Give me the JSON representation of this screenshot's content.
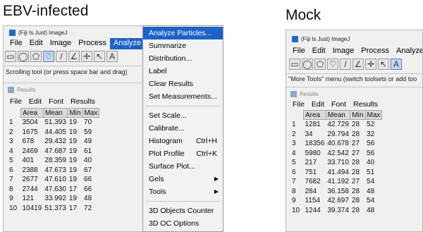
{
  "captions": {
    "left": "EBV-infected",
    "right": "Mock"
  },
  "left": {
    "title": "(Fiji Is Just) ImageJ",
    "menus": [
      "File",
      "Edit",
      "Image",
      "Process",
      "Analyze"
    ],
    "active_menu": "Analyze",
    "status": "Scrolling tool (or press space bar and drag)",
    "results_title": "Results",
    "results_menus": [
      "File",
      "Edit",
      "Font",
      "Results"
    ],
    "columns": [
      "",
      "Area",
      "Mean",
      "Min",
      "Max"
    ],
    "rows": [
      [
        "1",
        "3504",
        "51.393",
        "19",
        "70"
      ],
      [
        "2",
        "1675",
        "44.405",
        "19",
        "59"
      ],
      [
        "3",
        "678",
        "29.432",
        "19",
        "49"
      ],
      [
        "4",
        "2469",
        "47.687",
        "19",
        "61"
      ],
      [
        "5",
        "401",
        "28.359",
        "19",
        "40"
      ],
      [
        "6",
        "2388",
        "47.673",
        "19",
        "67"
      ],
      [
        "7",
        "2677",
        "47.610",
        "19",
        "66"
      ],
      [
        "8",
        "2744",
        "47.630",
        "17",
        "66"
      ],
      [
        "9",
        "121",
        "33.992",
        "19",
        "48"
      ],
      [
        "10",
        "10419",
        "51.373",
        "17",
        "72"
      ]
    ]
  },
  "analyze_menu": {
    "items": [
      {
        "label": "Analyze Particles...",
        "highlighted": true
      },
      {
        "label": "Summarize"
      },
      {
        "label": "Distribution..."
      },
      {
        "label": "Label"
      },
      {
        "label": "Clear Results"
      },
      {
        "label": "Set Measurements..."
      },
      {
        "label": "Set Scale...",
        "sep_before": true
      },
      {
        "label": "Calibrate..."
      },
      {
        "label": "Histogram",
        "shortcut": "Ctrl+H"
      },
      {
        "label": "Plot Profile",
        "shortcut": "Ctrl+K"
      },
      {
        "label": "Surface Plot..."
      },
      {
        "label": "Gels",
        "submenu": true
      },
      {
        "label": "Tools",
        "submenu": true
      },
      {
        "label": "3D Objects Counter",
        "sep_before": true
      },
      {
        "label": "3D OC Options"
      }
    ]
  },
  "right": {
    "title": "(Fiji Is Just) ImageJ",
    "menus": [
      "File",
      "Edit",
      "Image",
      "Process",
      "Analyze"
    ],
    "status": "\"More Tools\" menu (switch toolsets or add too",
    "results_title": "Results",
    "results_menus": [
      "File",
      "Edit",
      "Font",
      "Results"
    ],
    "columns": [
      "",
      "Area",
      "Mean",
      "Min",
      "Max"
    ],
    "rows": [
      [
        "1",
        "1281",
        "42.729",
        "28",
        "52"
      ],
      [
        "2",
        "34",
        "29.794",
        "28",
        "32"
      ],
      [
        "3",
        "18356",
        "40.678",
        "27",
        "56"
      ],
      [
        "4",
        "5980",
        "42.542",
        "27",
        "56"
      ],
      [
        "5",
        "217",
        "33.710",
        "28",
        "40"
      ],
      [
        "6",
        "751",
        "41.494",
        "28",
        "51"
      ],
      [
        "7",
        "7682",
        "41.192",
        "27",
        "54"
      ],
      [
        "8",
        "284",
        "36.158",
        "28",
        "48"
      ],
      [
        "9",
        "1154",
        "42.697",
        "28",
        "54"
      ],
      [
        "10",
        "1244",
        "39.374",
        "28",
        "48"
      ]
    ]
  }
}
